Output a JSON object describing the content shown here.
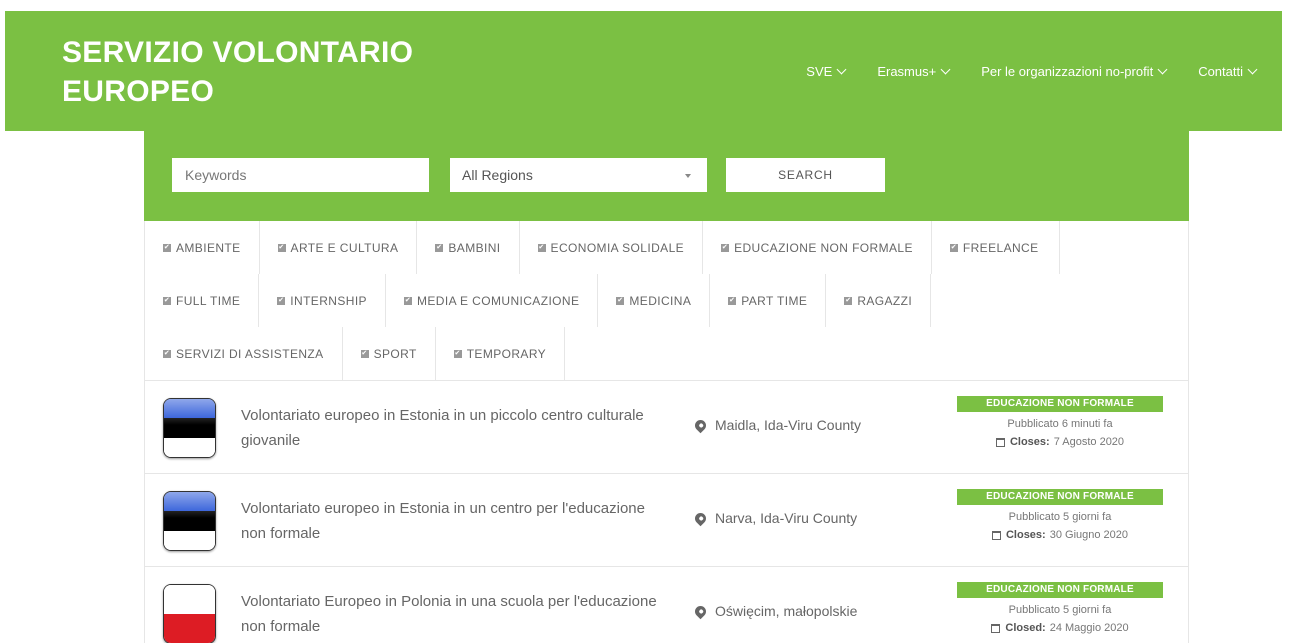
{
  "header": {
    "brand_line1": "SERVIZIO VOLONTARIO",
    "brand_line2": "EUROPEO",
    "nav": [
      "SVE",
      "Erasmus+",
      "Per le organizzazioni no-profit",
      "Contatti"
    ]
  },
  "search": {
    "keywords_placeholder": "Keywords",
    "region_selected": "All Regions",
    "button_label": "SEARCH"
  },
  "filters": {
    "row1": [
      "AMBIENTE",
      "ARTE E CULTURA",
      "BAMBINI",
      "ECONOMIA SOLIDALE",
      "EDUCAZIONE NON FORMALE",
      "FREELANCE"
    ],
    "row2": [
      "FULL TIME",
      "INTERNSHIP",
      "MEDIA E COMUNICAZIONE",
      "MEDICINA",
      "PART TIME",
      "RAGAZZI"
    ],
    "row3": [
      "SERVIZI DI ASSISTENZA",
      "SPORT",
      "TEMPORARY"
    ]
  },
  "jobs": [
    {
      "title": "Volontariato europeo in Estonia in un piccolo centro culturale giovanile",
      "location": "Maidla, Ida-Viru County",
      "badge": "EDUCAZIONE NON FORMALE",
      "posted": "Pubblicato 6 minuti fa",
      "deadline_label": "Closes:",
      "deadline": "7 Agosto 2020",
      "flag_colors": [
        "#1f4fd6",
        "#000000",
        "#ffffff"
      ]
    },
    {
      "title": "Volontariato europeo in Estonia in un centro per l'educazione non formale",
      "location": "Narva, Ida-Viru County",
      "badge": "EDUCAZIONE NON FORMALE",
      "posted": "Pubblicato 5 giorni fa",
      "deadline_label": "Closes:",
      "deadline": "30 Giugno 2020",
      "flag_colors": [
        "#1f4fd6",
        "#000000",
        "#ffffff"
      ]
    },
    {
      "title": "Volontariato Europeo in Polonia in una scuola per l'educazione non formale",
      "location": "Oświęcim, małopolskie",
      "badge": "EDUCAZIONE NON FORMALE",
      "posted": "Pubblicato 5 giorni fa",
      "deadline_label": "Closed:",
      "deadline": "24 Maggio 2020",
      "flag_colors": [
        "#ffffff",
        "#dd1c24"
      ]
    }
  ],
  "colors": {
    "brand_green": "#7bc043"
  }
}
